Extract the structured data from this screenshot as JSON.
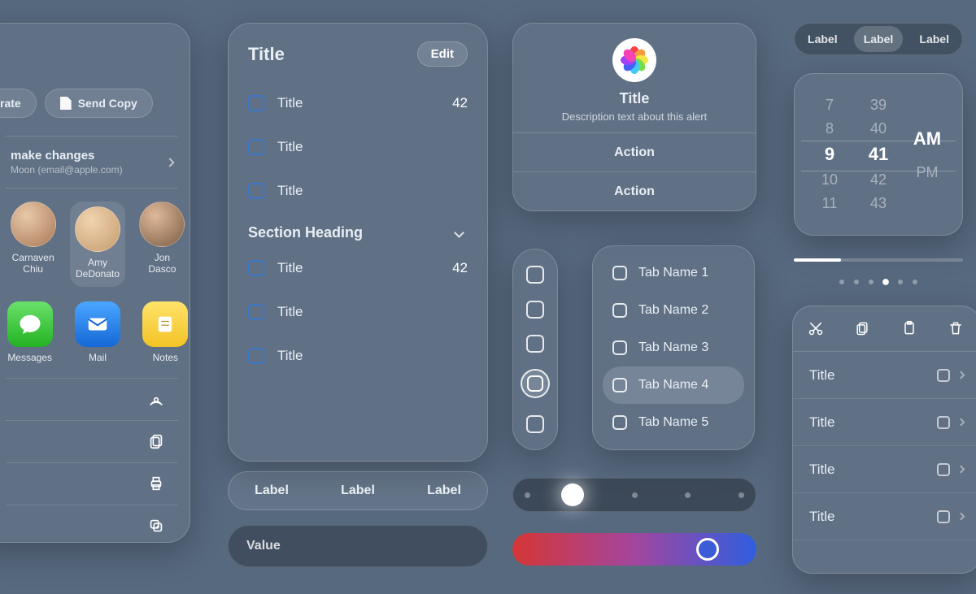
{
  "share": {
    "collab_btn": "rate",
    "send_copy_btn": "Send Copy",
    "make_changes_title": "make changes",
    "make_changes_sub": "Moon (email@apple.com)",
    "people": [
      {
        "name_line1": "Carnaven",
        "name_line2": "Chiu"
      },
      {
        "name_line1": "Amy",
        "name_line2": "DeDonato"
      },
      {
        "name_line1": "Jon",
        "name_line2": "Dasco"
      }
    ],
    "apps": [
      {
        "key": "messages",
        "label": "Messages"
      },
      {
        "key": "mail",
        "label": "Mail"
      },
      {
        "key": "notes",
        "label": "Notes"
      }
    ]
  },
  "settings": {
    "header": "Title",
    "edit": "Edit",
    "section_heading": "Section Heading",
    "rows_a": [
      {
        "label": "Title",
        "value": "42"
      },
      {
        "label": "Title"
      },
      {
        "label": "Title"
      }
    ],
    "rows_b": [
      {
        "label": "Title",
        "value": "42"
      },
      {
        "label": "Title"
      },
      {
        "label": "Title"
      }
    ]
  },
  "labelbar": {
    "a": "Label",
    "b": "Label",
    "c": "Label"
  },
  "valuebar": {
    "placeholder": "Value"
  },
  "alert": {
    "title": "Title",
    "desc": "Description text about this alert",
    "action1": "Action",
    "action2": "Action"
  },
  "tabs": {
    "items": [
      {
        "label": "Tab Name 1"
      },
      {
        "label": "Tab Name 2"
      },
      {
        "label": "Tab Name 3"
      },
      {
        "label": "Tab Name 4",
        "selected": true
      },
      {
        "label": "Tab Name 5"
      }
    ]
  },
  "segmented": {
    "a": "Label",
    "b": "Label",
    "c": "Label"
  },
  "timepicker": {
    "hours": [
      "7",
      "8",
      "9",
      "10",
      "11"
    ],
    "minutes": [
      "39",
      "40",
      "41",
      "42",
      "43"
    ],
    "ampm": [
      "AM",
      "PM"
    ],
    "selected": {
      "hour": "9",
      "minute": "41",
      "ampm": "AM"
    }
  },
  "progress": {
    "percent": 28
  },
  "page_dots": {
    "count": 6,
    "selected_index": 3
  },
  "toolbar_list": {
    "rows": [
      {
        "label": "Title"
      },
      {
        "label": "Title"
      },
      {
        "label": "Title"
      },
      {
        "label": "Title"
      }
    ]
  }
}
